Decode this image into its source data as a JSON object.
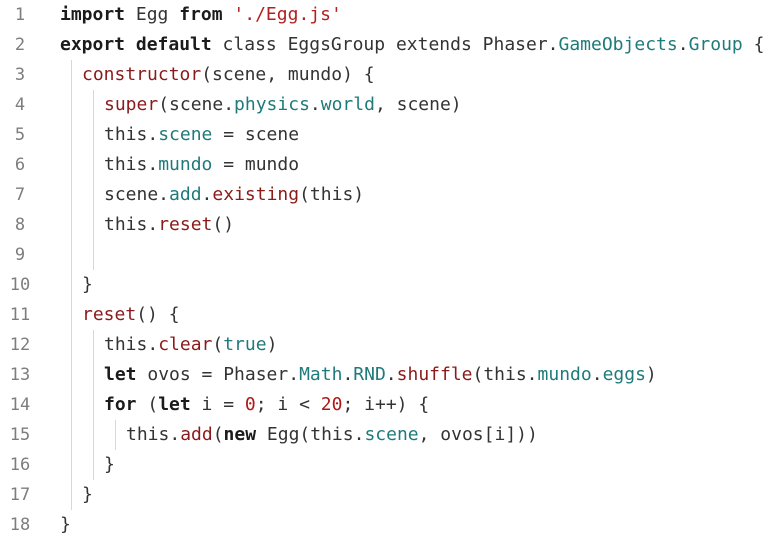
{
  "editor": {
    "language": "javascript",
    "colors": {
      "background": "#ffffff",
      "line_number": "#7d7d7d",
      "keyword": "#1b1b1b",
      "function": "#8b1a1a",
      "property": "#1f7a7a",
      "string": "#b32020",
      "number": "#b01818",
      "indent_guide": "#d8d8d8"
    },
    "lines": [
      {
        "number": "1",
        "indent": 0,
        "tokens": [
          {
            "t": "import",
            "c": "kw"
          },
          {
            "t": " Egg ",
            "c": "txt"
          },
          {
            "t": "from",
            "c": "kw"
          },
          {
            "t": " ",
            "c": "txt"
          },
          {
            "t": "'./Egg.js'",
            "c": "str"
          }
        ]
      },
      {
        "number": "2",
        "indent": 0,
        "tokens": [
          {
            "t": "export default",
            "c": "kw"
          },
          {
            "t": " class EggsGroup extends Phaser.",
            "c": "txt"
          },
          {
            "t": "GameObjects",
            "c": "prop"
          },
          {
            "t": ".",
            "c": "txt"
          },
          {
            "t": "Group",
            "c": "prop"
          },
          {
            "t": " {",
            "c": "txt"
          }
        ]
      },
      {
        "number": "3",
        "indent": 1,
        "tokens": [
          {
            "t": "constructor",
            "c": "fn"
          },
          {
            "t": "(scene, mundo) {",
            "c": "txt"
          }
        ]
      },
      {
        "number": "4",
        "indent": 2,
        "tokens": [
          {
            "t": "super",
            "c": "fn"
          },
          {
            "t": "(scene.",
            "c": "txt"
          },
          {
            "t": "physics",
            "c": "prop"
          },
          {
            "t": ".",
            "c": "txt"
          },
          {
            "t": "world",
            "c": "prop"
          },
          {
            "t": ", scene)",
            "c": "txt"
          }
        ]
      },
      {
        "number": "5",
        "indent": 2,
        "tokens": [
          {
            "t": "this.",
            "c": "txt"
          },
          {
            "t": "scene",
            "c": "prop"
          },
          {
            "t": " = scene",
            "c": "txt"
          }
        ]
      },
      {
        "number": "6",
        "indent": 2,
        "tokens": [
          {
            "t": "this.",
            "c": "txt"
          },
          {
            "t": "mundo",
            "c": "prop"
          },
          {
            "t": " = mundo",
            "c": "txt"
          }
        ]
      },
      {
        "number": "7",
        "indent": 2,
        "tokens": [
          {
            "t": "scene.",
            "c": "txt"
          },
          {
            "t": "add",
            "c": "prop"
          },
          {
            "t": ".",
            "c": "txt"
          },
          {
            "t": "existing",
            "c": "fn"
          },
          {
            "t": "(this)",
            "c": "txt"
          }
        ]
      },
      {
        "number": "8",
        "indent": 2,
        "tokens": [
          {
            "t": "this.",
            "c": "txt"
          },
          {
            "t": "reset",
            "c": "fn"
          },
          {
            "t": "()",
            "c": "txt"
          }
        ]
      },
      {
        "number": "9",
        "indent": 2,
        "tokens": []
      },
      {
        "number": "10",
        "indent": 1,
        "tokens": [
          {
            "t": "}",
            "c": "txt"
          }
        ]
      },
      {
        "number": "11",
        "indent": 1,
        "tokens": [
          {
            "t": "reset",
            "c": "fn"
          },
          {
            "t": "() {",
            "c": "txt"
          }
        ]
      },
      {
        "number": "12",
        "indent": 2,
        "tokens": [
          {
            "t": "this.",
            "c": "txt"
          },
          {
            "t": "clear",
            "c": "fn"
          },
          {
            "t": "(",
            "c": "txt"
          },
          {
            "t": "true",
            "c": "prop"
          },
          {
            "t": ")",
            "c": "txt"
          }
        ]
      },
      {
        "number": "13",
        "indent": 2,
        "tokens": [
          {
            "t": "let",
            "c": "kw"
          },
          {
            "t": " ovos = Phaser.",
            "c": "txt"
          },
          {
            "t": "Math",
            "c": "prop"
          },
          {
            "t": ".",
            "c": "txt"
          },
          {
            "t": "RND",
            "c": "prop"
          },
          {
            "t": ".",
            "c": "txt"
          },
          {
            "t": "shuffle",
            "c": "fn"
          },
          {
            "t": "(this.",
            "c": "txt"
          },
          {
            "t": "mundo",
            "c": "prop"
          },
          {
            "t": ".",
            "c": "txt"
          },
          {
            "t": "eggs",
            "c": "prop"
          },
          {
            "t": ")",
            "c": "txt"
          }
        ]
      },
      {
        "number": "14",
        "indent": 2,
        "tokens": [
          {
            "t": "for",
            "c": "kw"
          },
          {
            "t": " (",
            "c": "txt"
          },
          {
            "t": "let",
            "c": "kw"
          },
          {
            "t": " i = ",
            "c": "txt"
          },
          {
            "t": "0",
            "c": "num"
          },
          {
            "t": "; i < ",
            "c": "txt"
          },
          {
            "t": "20",
            "c": "num"
          },
          {
            "t": "; i++) {",
            "c": "txt"
          }
        ]
      },
      {
        "number": "15",
        "indent": 3,
        "tokens": [
          {
            "t": "this.",
            "c": "txt"
          },
          {
            "t": "add",
            "c": "fn"
          },
          {
            "t": "(",
            "c": "txt"
          },
          {
            "t": "new",
            "c": "kw"
          },
          {
            "t": " Egg(this.",
            "c": "txt"
          },
          {
            "t": "scene",
            "c": "prop"
          },
          {
            "t": ", ovos[i]))",
            "c": "txt"
          }
        ]
      },
      {
        "number": "16",
        "indent": 2,
        "tokens": [
          {
            "t": "}",
            "c": "txt"
          }
        ]
      },
      {
        "number": "17",
        "indent": 1,
        "tokens": [
          {
            "t": "}",
            "c": "txt"
          }
        ]
      },
      {
        "number": "18",
        "indent": 0,
        "tokens": [
          {
            "t": "}",
            "c": "txt"
          }
        ]
      }
    ]
  }
}
